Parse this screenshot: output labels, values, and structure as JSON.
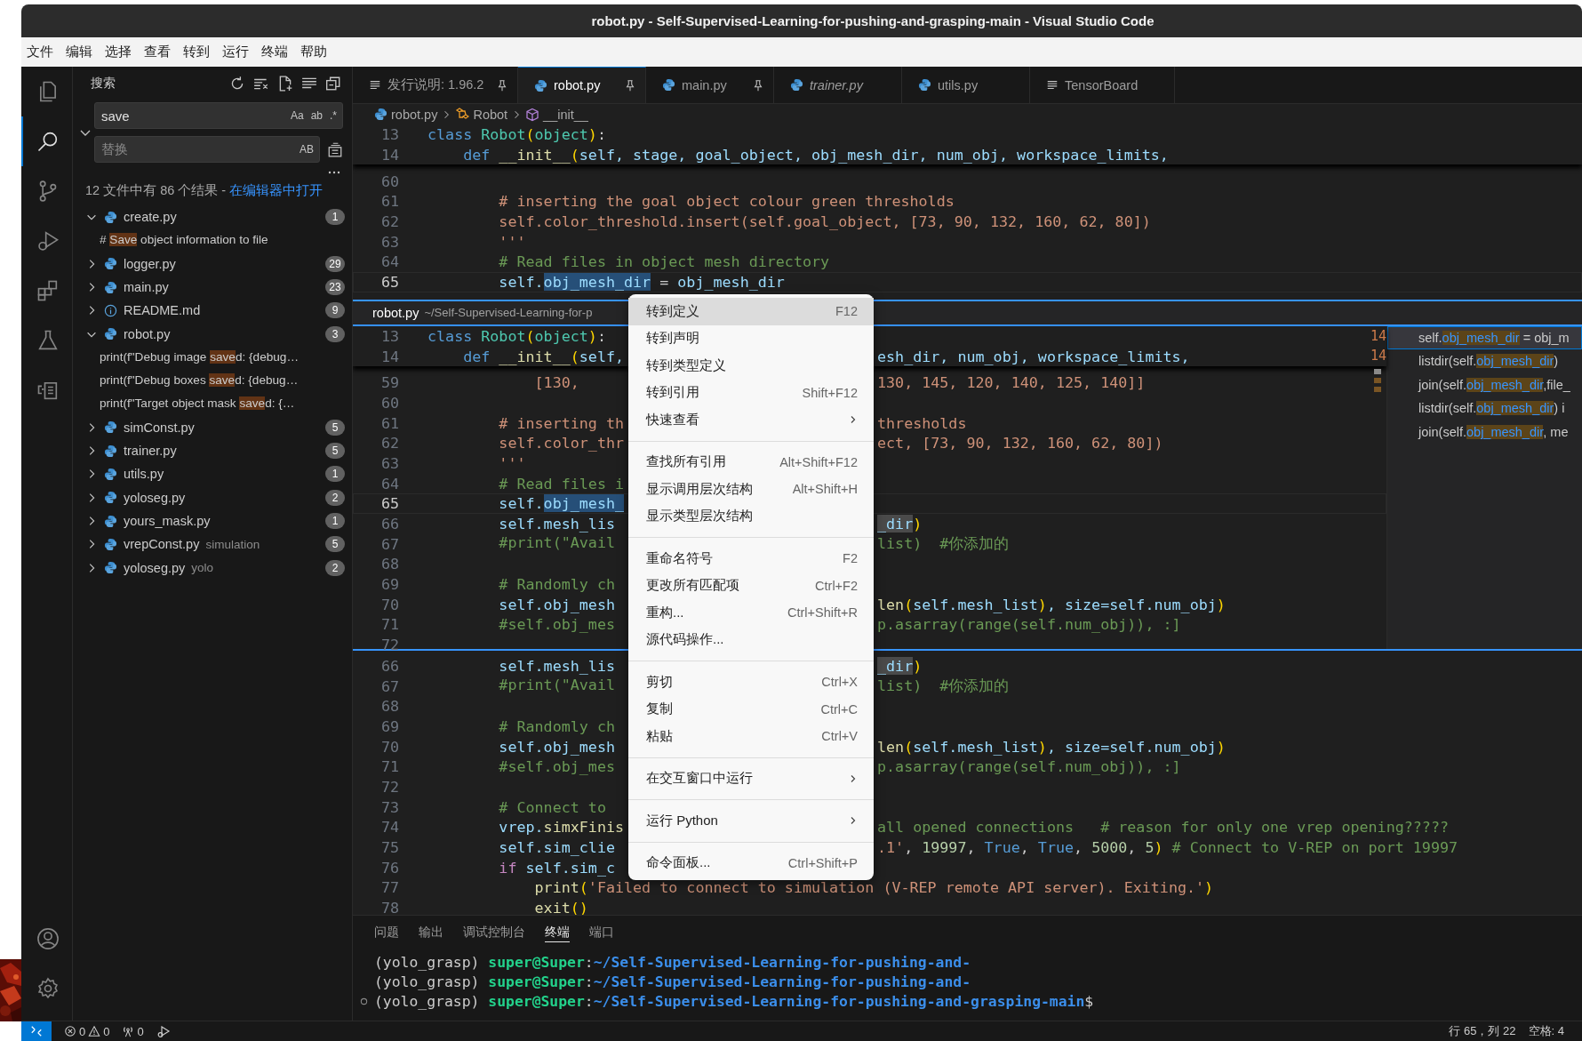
{
  "window": {
    "title": "robot.py - Self-Supervised-Learning-for-pushing-and-grasping-main - Visual Studio Code"
  },
  "menu_bar": [
    "文件",
    "编辑",
    "选择",
    "查看",
    "转到",
    "运行",
    "终端",
    "帮助"
  ],
  "activity_bar": {
    "top": [
      {
        "kind": "explorer",
        "selected": false
      },
      {
        "kind": "search",
        "selected": true
      },
      {
        "kind": "source-control",
        "selected": false
      },
      {
        "kind": "run-debug",
        "selected": false
      },
      {
        "kind": "extensions",
        "selected": false
      },
      {
        "kind": "testing",
        "selected": false
      },
      {
        "kind": "notebook",
        "selected": false
      }
    ],
    "bottom": [
      {
        "kind": "account"
      },
      {
        "kind": "settings"
      }
    ]
  },
  "sidebar": {
    "title": "搜索",
    "search": {
      "value": "save",
      "toggles": [
        "Aa",
        "ab",
        ".*"
      ]
    },
    "replace": {
      "placeholder": "替换",
      "toggle": "AB"
    },
    "summary": {
      "text": "12 文件中有 86 个结果 - ",
      "link": "在编辑器中打开"
    },
    "results": [
      {
        "name": "create.py",
        "kind": "python",
        "count": "1",
        "expanded": true,
        "matches": [
          {
            "before": "# ",
            "match": "Save",
            "after": " object information to file"
          }
        ]
      },
      {
        "name": "logger.py",
        "kind": "python",
        "count": "29",
        "expanded": false
      },
      {
        "name": "main.py",
        "kind": "python",
        "count": "23",
        "expanded": false
      },
      {
        "name": "README.md",
        "kind": "info",
        "count": "9",
        "expanded": false
      },
      {
        "name": "robot.py",
        "kind": "python",
        "count": "3",
        "expanded": true,
        "matches": [
          {
            "before": "print(f\"Debug image ",
            "match": "save",
            "after": "d: {debug…"
          },
          {
            "before": "print(f\"Debug boxes ",
            "match": "save",
            "after": "d: {debug…"
          },
          {
            "before": "print(f\"Target object mask ",
            "match": "save",
            "after": "d: {…"
          }
        ]
      },
      {
        "name": "simConst.py",
        "kind": "python",
        "count": "5",
        "expanded": false
      },
      {
        "name": "trainer.py",
        "kind": "python",
        "count": "5",
        "expanded": false
      },
      {
        "name": "utils.py",
        "kind": "python",
        "count": "1",
        "expanded": false
      },
      {
        "name": "yoloseg.py",
        "kind": "python",
        "count": "2",
        "expanded": false
      },
      {
        "name": "yours_mask.py",
        "kind": "python",
        "count": "1",
        "expanded": false
      },
      {
        "name": "vrepConst.py",
        "description": "simulation",
        "kind": "python",
        "count": "5",
        "expanded": false
      },
      {
        "name": "yoloseg.py",
        "description": "yolo",
        "kind": "python",
        "count": "2",
        "expanded": false
      }
    ]
  },
  "tabs": [
    {
      "label": "发行说明: 1.96.2",
      "kind": "doc",
      "pinned": true,
      "preview": false,
      "selected": false
    },
    {
      "label": "robot.py",
      "kind": "python",
      "pinned": true,
      "preview": false,
      "selected": true
    },
    {
      "label": "main.py",
      "kind": "python",
      "pinned": true,
      "preview": false,
      "selected": false
    },
    {
      "label": "trainer.py",
      "kind": "python",
      "pinned": false,
      "preview": true,
      "selected": false
    },
    {
      "label": "utils.py",
      "kind": "python",
      "pinned": false,
      "preview": false,
      "selected": false
    },
    {
      "label": "TensorBoard",
      "kind": "doc",
      "pinned": false,
      "preview": false,
      "selected": false
    }
  ],
  "breadcrumb": [
    {
      "label": "robot.py",
      "kind": "python"
    },
    {
      "label": "Robot",
      "kind": "class"
    },
    {
      "label": "__init__",
      "kind": "method"
    }
  ],
  "editor": {
    "sticky": [
      {
        "n": "13",
        "code": [
          {
            "text": "class",
            "kind": "keyword"
          },
          {
            "text": " Robot",
            "kind": "class"
          },
          {
            "text": "(",
            "kind": "bracket"
          },
          {
            "text": "object",
            "kind": "class"
          },
          {
            "text": ")",
            "kind": "bracket"
          },
          {
            "text": ":",
            "kind": "plain"
          }
        ]
      },
      {
        "n": "14",
        "code": [
          {
            "text": "    def",
            "kind": "keyword"
          },
          {
            "text": " __init__",
            "kind": "function"
          },
          {
            "text": "(",
            "kind": "bracket"
          },
          {
            "text": "self, stage, goal_object, obj_mesh_dir, num_obj, workspace_limits,",
            "kind": "variable"
          }
        ]
      }
    ],
    "lines": [
      {
        "n": "60"
      },
      {
        "n": "61",
        "code": [
          {
            "text": "        # inserting the goal object colour green thresholds",
            "kind": "string"
          }
        ]
      },
      {
        "n": "62",
        "code": [
          {
            "text": "        self.color_threshold.insert(self.goal_object, [73, 90, 132, 160, 62, 80])",
            "kind": "string"
          }
        ]
      },
      {
        "n": "63",
        "code": [
          {
            "text": "        '''",
            "kind": "string"
          }
        ]
      },
      {
        "n": "64",
        "code": [
          {
            "text": "        # Read files in object mesh directory",
            "kind": "comment"
          }
        ]
      },
      {
        "n": "65",
        "current": true,
        "code": [
          {
            "text": "        self.",
            "kind": "variable"
          },
          {
            "text": "obj_mesh_dir",
            "kind": "selection"
          },
          {
            "text": " = ",
            "kind": "plain"
          },
          {
            "text": "obj_mesh_dir",
            "kind": "variable"
          }
        ]
      }
    ],
    "peek": {
      "file": "robot.py",
      "path": "~/Self-Supervised-Learning-for-p",
      "sticky": [
        {
          "n": "13",
          "code": [
            {
              "text": "class",
              "kind": "keyword"
            },
            {
              "text": " Robot",
              "kind": "class"
            },
            {
              "text": "(",
              "kind": "bracket"
            },
            {
              "text": "object",
              "kind": "class"
            },
            {
              "text": ")",
              "kind": "bracket"
            },
            {
              "text": ":",
              "kind": "plain"
            }
          ]
        },
        {
          "n": "14",
          "code": [
            {
              "text": "    def",
              "kind": "keyword"
            },
            {
              "text": " __init__",
              "kind": "function"
            },
            {
              "text": "(",
              "kind": "bracket"
            },
            {
              "text": "self,",
              "kind": "variable"
            }
          ],
          "right": [
            {
              "text": "esh_dir, num_obj, workspace_limits,",
              "kind": "variable"
            }
          ]
        }
      ],
      "lines": [
        {
          "n": "59",
          "code": [
            {
              "text": "            [130,",
              "kind": "string"
            }
          ],
          "right": [
            {
              "text": "130, 145, 120, 140, 125, 140]]",
              "kind": "string"
            }
          ]
        },
        {
          "n": "60"
        },
        {
          "n": "61",
          "code": [
            {
              "text": "        # inserting th",
              "kind": "string"
            }
          ],
          "right": [
            {
              "text": "thresholds",
              "kind": "string"
            }
          ]
        },
        {
          "n": "62",
          "code": [
            {
              "text": "        self.color_thr",
              "kind": "string"
            }
          ],
          "right": [
            {
              "text": "ect, [73, 90, 132, 160, 62, 80])",
              "kind": "string"
            }
          ]
        },
        {
          "n": "63",
          "code": [
            {
              "text": "        '''",
              "kind": "string"
            }
          ]
        },
        {
          "n": "64",
          "code": [
            {
              "text": "        # Read files i",
              "kind": "comment"
            }
          ]
        },
        {
          "n": "65",
          "current": true,
          "code": [
            {
              "text": "        self.",
              "kind": "variable"
            },
            {
              "text": "obj_mesh_",
              "kind": "selection"
            }
          ]
        },
        {
          "n": "66",
          "code": [
            {
              "text": "        self.mesh_lis",
              "kind": "variable"
            }
          ],
          "right": [
            {
              "text": "_dir",
              "kind": "reference"
            },
            {
              "text": ")",
              "kind": "bracket"
            }
          ]
        },
        {
          "n": "67",
          "code": [
            {
              "text": "        #print(\"Avail",
              "kind": "comment"
            }
          ],
          "right": [
            {
              "text": "list)  #你添加的",
              "kind": "comment"
            }
          ]
        },
        {
          "n": "68"
        },
        {
          "n": "69",
          "code": [
            {
              "text": "        # Randomly ch",
              "kind": "comment"
            }
          ]
        },
        {
          "n": "70",
          "code": [
            {
              "text": "        self.obj_mesh",
              "kind": "variable"
            }
          ],
          "right": [
            {
              "text": "len",
              "kind": "function"
            },
            {
              "text": "(",
              "kind": "bracket"
            },
            {
              "text": "self.mesh_list",
              "kind": "variable"
            },
            {
              "text": ")",
              "kind": "bracket"
            },
            {
              "text": ", size=self.num_obj",
              "kind": "variable"
            },
            {
              "text": ")",
              "kind": "bracket"
            }
          ]
        },
        {
          "n": "71",
          "code": [
            {
              "text": "        #self.obj_mes",
              "kind": "comment"
            }
          ],
          "right": [
            {
              "text": "p.asarray(range(self.num_obj)), :]",
              "kind": "comment"
            }
          ]
        },
        {
          "n": "72"
        }
      ],
      "minimap_numbers": [
        "14",
        "14"
      ],
      "references": [
        {
          "before": "self.",
          "match": "obj_mesh_dir",
          "after": " = obj_m",
          "selected": true
        },
        {
          "before": "listdir(self.",
          "match": "obj_mesh_dir",
          "after": ")",
          "selected": false
        },
        {
          "before": "join(self.",
          "match": "obj_mesh_dir",
          "after": ",file_",
          "selected": false
        },
        {
          "before": "listdir(self.",
          "match": "obj_mesh_dir",
          "after": ") i",
          "selected": false
        },
        {
          "before": "join(self.",
          "match": "obj_mesh_dir",
          "after": ", me",
          "selected": false
        }
      ]
    },
    "after_peek": [
      {
        "n": "66",
        "code": [
          {
            "text": "        self.mesh_lis",
            "kind": "variable"
          }
        ],
        "right": [
          {
            "text": "_dir",
            "kind": "reference"
          },
          {
            "text": ")",
            "kind": "bracket"
          }
        ]
      },
      {
        "n": "67",
        "code": [
          {
            "text": "        #print(\"Avail",
            "kind": "comment"
          }
        ],
        "right": [
          {
            "text": "list)  #你添加的",
            "kind": "comment"
          }
        ]
      },
      {
        "n": "68"
      },
      {
        "n": "69",
        "code": [
          {
            "text": "        # Randomly ch",
            "kind": "comment"
          }
        ]
      },
      {
        "n": "70",
        "code": [
          {
            "text": "        self.obj_mesh",
            "kind": "variable"
          }
        ],
        "right": [
          {
            "text": "len",
            "kind": "function"
          },
          {
            "text": "(",
            "kind": "bracket"
          },
          {
            "text": "self.mesh_list",
            "kind": "variable"
          },
          {
            "text": ")",
            "kind": "bracket"
          },
          {
            "text": ", size=self.num_obj",
            "kind": "variable"
          },
          {
            "text": ")",
            "kind": "bracket"
          }
        ]
      },
      {
        "n": "71",
        "code": [
          {
            "text": "        #self.obj_mes",
            "kind": "comment"
          }
        ],
        "right": [
          {
            "text": "p.asarray(range(self.num_obj)), :]",
            "kind": "comment"
          }
        ]
      },
      {
        "n": "72"
      },
      {
        "n": "73",
        "code": [
          {
            "text": "        # Connect to",
            "kind": "comment"
          }
        ]
      },
      {
        "n": "74",
        "code": [
          {
            "text": "        vrep.",
            "kind": "variable"
          },
          {
            "text": "simxFinis",
            "kind": "function"
          }
        ],
        "right": [
          {
            "text": "all opened connections   # reason for only one vrep opening?????",
            "kind": "comment"
          }
        ]
      },
      {
        "n": "75",
        "code": [
          {
            "text": "        self.sim_clie",
            "kind": "variable"
          }
        ],
        "right": [
          {
            "text": ".1'",
            "kind": "string"
          },
          {
            "text": ", ",
            "kind": "plain"
          },
          {
            "text": "19997",
            "kind": "number"
          },
          {
            "text": ", ",
            "kind": "plain"
          },
          {
            "text": "True",
            "kind": "keyword"
          },
          {
            "text": ", ",
            "kind": "plain"
          },
          {
            "text": "True",
            "kind": "keyword"
          },
          {
            "text": ", ",
            "kind": "plain"
          },
          {
            "text": "5000",
            "kind": "number"
          },
          {
            "text": ", ",
            "kind": "plain"
          },
          {
            "text": "5",
            "kind": "number"
          },
          {
            "text": ")",
            "kind": "bracket"
          },
          {
            "text": " # Connect to V-REP on port 19997",
            "kind": "comment"
          }
        ]
      },
      {
        "n": "76",
        "code": [
          {
            "text": "        if",
            "kind": "control"
          },
          {
            "text": " self.sim_c",
            "kind": "variable"
          }
        ]
      },
      {
        "n": "77",
        "code": [
          {
            "text": "            print",
            "kind": "function"
          },
          {
            "text": "(",
            "kind": "bracket"
          },
          {
            "text": "'Failed to connect to simulation (V-REP remote API server). Exiting.'",
            "kind": "string"
          },
          {
            "text": ")",
            "kind": "bracket"
          }
        ]
      },
      {
        "n": "78",
        "code": [
          {
            "text": "            exit",
            "kind": "function"
          },
          {
            "text": "()",
            "kind": "bracket"
          }
        ]
      }
    ]
  },
  "context_menu": {
    "groups": [
      [
        {
          "label": "转到定义",
          "shortcut": "F12",
          "selected": true
        },
        {
          "label": "转到声明",
          "selected": false
        },
        {
          "label": "转到类型定义",
          "selected": false
        },
        {
          "label": "转到引用",
          "shortcut": "Shift+F12",
          "selected": false
        },
        {
          "label": "快速查看",
          "submenu": true,
          "selected": false
        }
      ],
      [
        {
          "label": "查找所有引用",
          "shortcut": "Alt+Shift+F12",
          "selected": false
        },
        {
          "label": "显示调用层次结构",
          "shortcut": "Alt+Shift+H",
          "selected": false
        },
        {
          "label": "显示类型层次结构",
          "selected": false
        }
      ],
      [
        {
          "label": "重命名符号",
          "shortcut": "F2",
          "selected": false
        },
        {
          "label": "更改所有匹配项",
          "shortcut": "Ctrl+F2",
          "selected": false
        },
        {
          "label": "重构...",
          "shortcut": "Ctrl+Shift+R",
          "selected": false
        },
        {
          "label": "源代码操作...",
          "selected": false
        }
      ],
      [
        {
          "label": "剪切",
          "shortcut": "Ctrl+X",
          "selected": false
        },
        {
          "label": "复制",
          "shortcut": "Ctrl+C",
          "selected": false
        },
        {
          "label": "粘贴",
          "shortcut": "Ctrl+V",
          "selected": false
        }
      ],
      [
        {
          "label": "在交互窗口中运行",
          "submenu": true,
          "selected": false
        }
      ],
      [
        {
          "label": "运行 Python",
          "submenu": true,
          "selected": false
        }
      ],
      [
        {
          "label": "命令面板...",
          "shortcut": "Ctrl+Shift+P",
          "selected": false
        }
      ]
    ]
  },
  "panel": {
    "tabs": [
      {
        "label": "问题",
        "selected": false
      },
      {
        "label": "输出",
        "selected": false
      },
      {
        "label": "调试控制台",
        "selected": false
      },
      {
        "label": "终端",
        "selected": true
      },
      {
        "label": "端口",
        "selected": false
      }
    ],
    "terminal": [
      {
        "env": "(yolo_grasp) ",
        "user": "super@Super",
        "sep": ":",
        "path": "~/Self-Supervised-Learning-for-pushing-and-",
        "marker": false
      },
      {
        "env": "(yolo_grasp) ",
        "user": "super@Super",
        "sep": ":",
        "path": "~/Self-Supervised-Learning-for-pushing-and-",
        "marker": false
      },
      {
        "env": "(yolo_grasp) ",
        "user": "super@Super",
        "sep": ":",
        "path": "~/Self-Supervised-Learning-for-pushing-and-grasping-main",
        "prompt": "$",
        "marker": true
      }
    ]
  },
  "status_bar": {
    "errors": "0",
    "warnings": "0",
    "ports": "0",
    "position": "行 65，列 22",
    "indent": "空格: 4"
  }
}
